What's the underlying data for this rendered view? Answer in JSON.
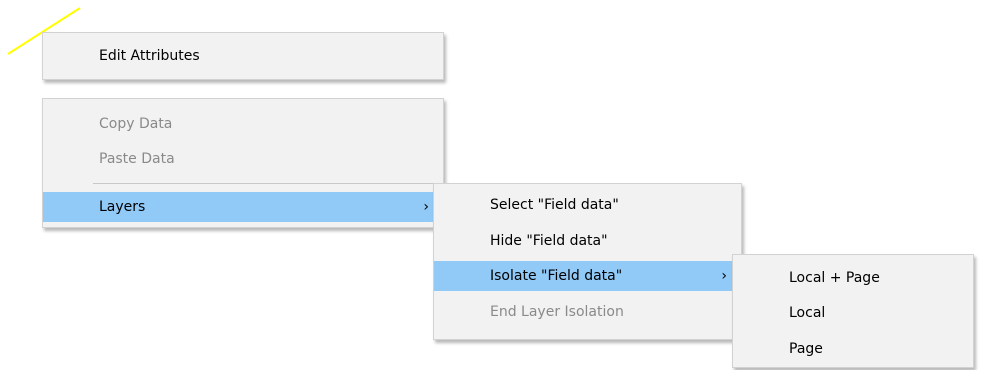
{
  "main_menu": {
    "items": [
      {
        "label": "Edit Attributes",
        "enabled": true
      },
      {
        "label": "Copy Data",
        "enabled": false
      },
      {
        "label": "Paste Data",
        "enabled": false
      },
      {
        "label": "Layers",
        "enabled": true,
        "has_submenu": true,
        "highlighted": true
      }
    ]
  },
  "layers_submenu": {
    "items": [
      {
        "label": "Select \"Field data\"",
        "enabled": true
      },
      {
        "label": "Hide \"Field data\"",
        "enabled": true
      },
      {
        "label": "Isolate \"Field data\"",
        "enabled": true,
        "has_submenu": true,
        "highlighted": true
      },
      {
        "label": "End Layer Isolation",
        "enabled": false
      }
    ]
  },
  "isolate_submenu": {
    "items": [
      {
        "label": "Local + Page",
        "enabled": true
      },
      {
        "label": "Local",
        "enabled": true
      },
      {
        "label": "Page",
        "enabled": true
      }
    ]
  },
  "icons": {
    "submenu_arrow": "chevron-right-icon"
  },
  "colors": {
    "menu_bg": "#f2f2f2",
    "highlight": "#91c9f7",
    "disabled_text": "#8a8a8a",
    "stroke": "#ffff00"
  }
}
